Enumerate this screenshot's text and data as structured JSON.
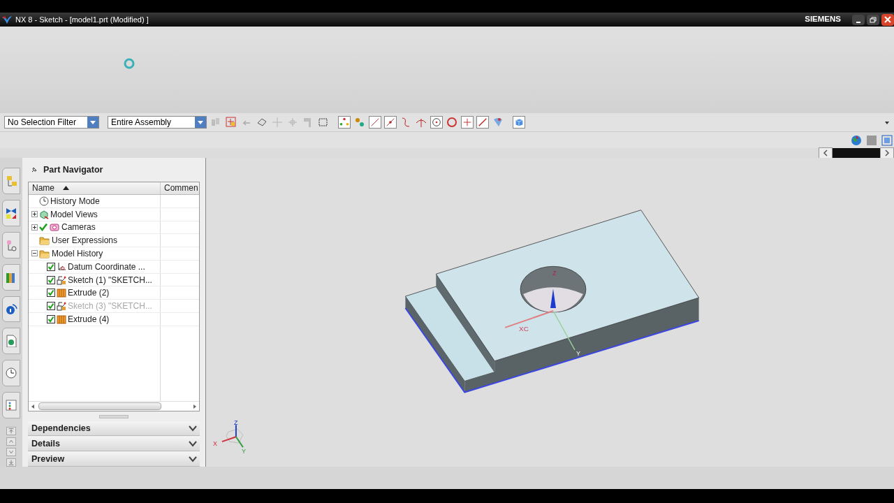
{
  "window": {
    "title": "NX 8 - Sketch - [model1.prt (Modified) ]",
    "brand": "SIEMENS"
  },
  "toolbar": {
    "selection_filter": "No Selection Filter",
    "scope": "Entire Assembly"
  },
  "navigator": {
    "title": "Part Navigator",
    "columns": [
      {
        "label": "Name",
        "sorted": true
      },
      {
        "label": "Commen",
        "sorted": false
      }
    ],
    "items": [
      {
        "label": "History Mode",
        "kind": "clock"
      },
      {
        "label": "Model Views",
        "kind": "views",
        "expanded": false
      },
      {
        "label": "Cameras",
        "kind": "camera",
        "expanded": false,
        "active": true
      },
      {
        "label": "User Expressions",
        "kind": "folder"
      },
      {
        "label": "Model History",
        "kind": "folder",
        "expanded": true,
        "children": [
          {
            "label": "Datum Coordinate ...",
            "kind": "datum",
            "checked": true,
            "dimmed": false
          },
          {
            "label": "Sketch (1) \"SKETCH...",
            "kind": "sketch",
            "checked": true,
            "dimmed": false
          },
          {
            "label": "Extrude (2)",
            "kind": "extrude",
            "checked": true,
            "dimmed": false
          },
          {
            "label": "Sketch (3) \"SKETCH...",
            "kind": "sketch",
            "checked": true,
            "dimmed": true
          },
          {
            "label": "Extrude (4)",
            "kind": "extrude",
            "checked": true,
            "dimmed": false
          }
        ]
      }
    ],
    "sections": [
      {
        "label": "Dependencies",
        "expanded": false
      },
      {
        "label": "Details",
        "expanded": false
      },
      {
        "label": "Preview",
        "expanded": false
      }
    ]
  },
  "viewport": {
    "csys_label": "XC",
    "csys_axes": [
      "Z",
      "Y"
    ],
    "triad_axes": [
      "Z",
      "X",
      "Y"
    ]
  }
}
